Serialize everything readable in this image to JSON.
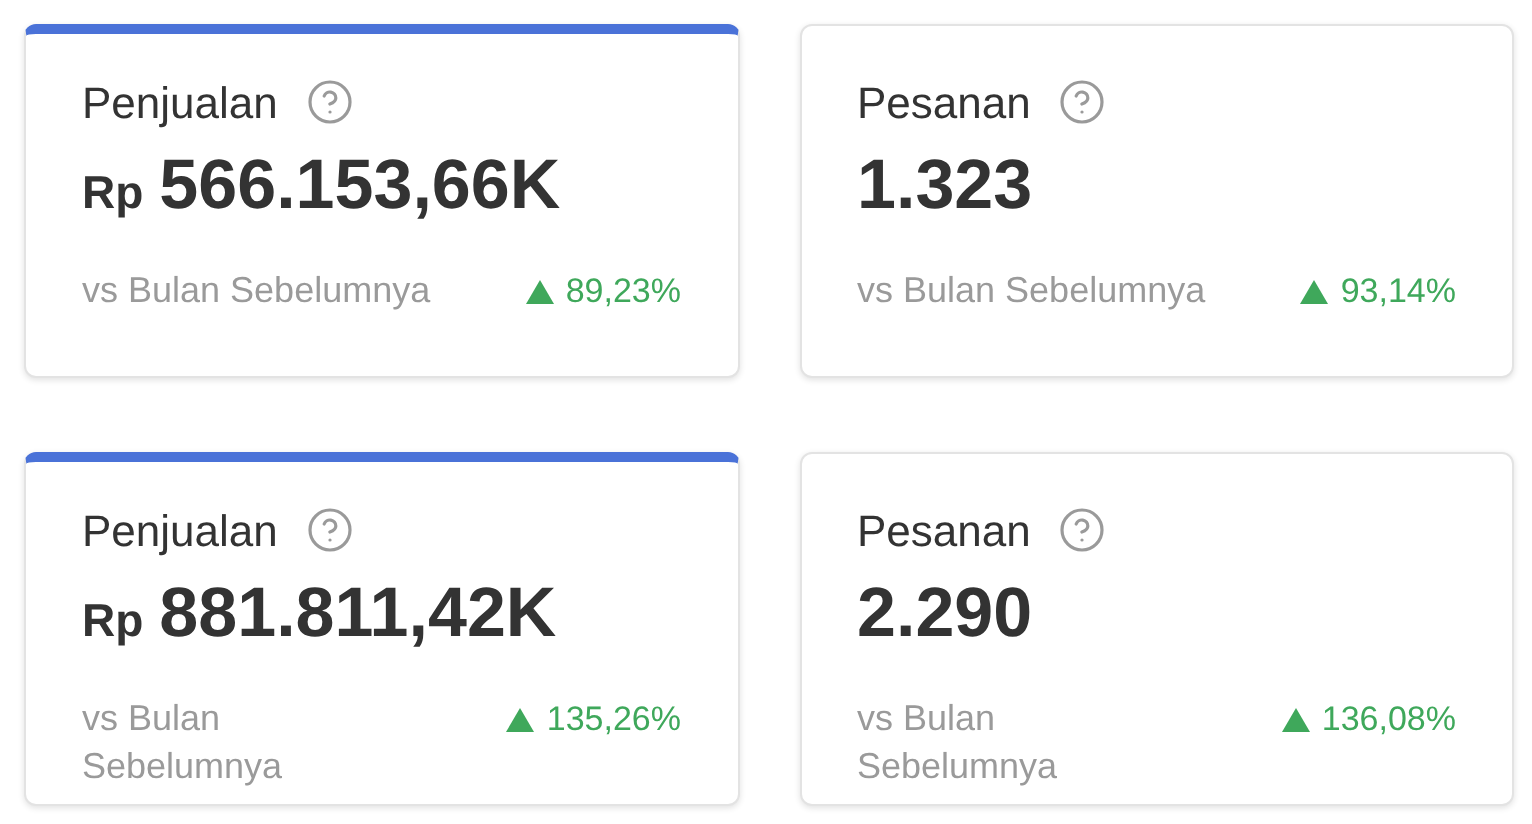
{
  "rows": [
    {
      "cards": [
        {
          "title": "Penjualan",
          "selected": true,
          "currency": "Rp",
          "value": "566.153,66K",
          "comparison": "vs Bulan Sebelumnya",
          "rising": true,
          "change": "89,23%"
        },
        {
          "title": "Pesanan",
          "selected": false,
          "value": "1.323",
          "comparison": "vs Bulan Sebelumnya",
          "rising": true,
          "change": "93,14%"
        }
      ]
    },
    {
      "cards": [
        {
          "title": "Penjualan",
          "selected": true,
          "currency": "Rp",
          "value": "881.811,42K",
          "comparison": "vs Bulan Sebelumnya",
          "rising": true,
          "change": "135,26%"
        },
        {
          "title": "Pesanan",
          "selected": false,
          "value": "2.290",
          "comparison": "vs Bulan Sebelumnya",
          "rising": true,
          "change": "136,08%"
        }
      ]
    }
  ]
}
